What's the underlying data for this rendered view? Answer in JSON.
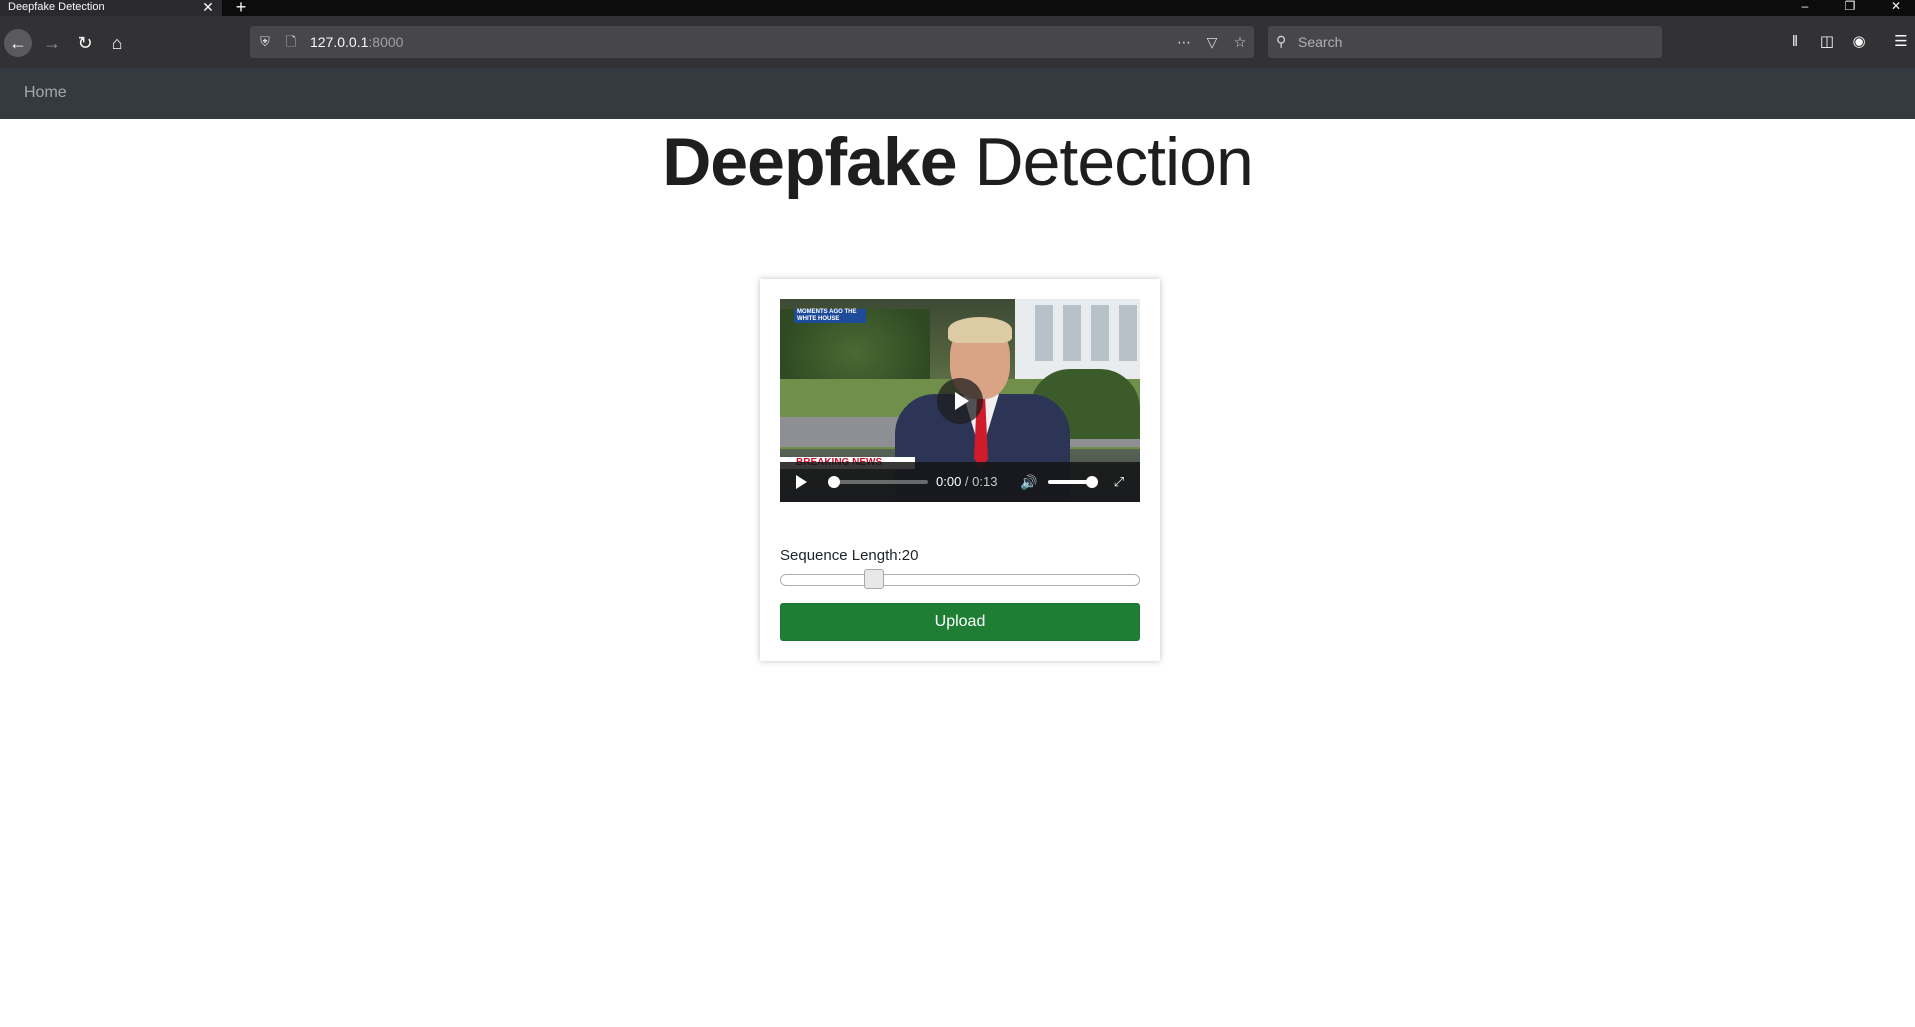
{
  "browser": {
    "tab_title": "Deepfake Detection",
    "tab_close": "✕",
    "new_tab": "+",
    "url_host": "127.0.0.1",
    "url_port": ":8000",
    "search_placeholder": "Search",
    "window_controls": [
      "–",
      "❐",
      "✕"
    ]
  },
  "site_nav": {
    "home_label": "Home"
  },
  "page": {
    "title_bold": "Deepfake",
    "title_light": "Detection"
  },
  "video": {
    "badge_text": "MOMENTS AGO THE WHITE HOUSE",
    "banner_text": "BREAKING NEWS",
    "current_time": "0:00",
    "separator": " / ",
    "duration": "0:13",
    "progress": 0.0,
    "volume": 1.0
  },
  "form": {
    "sequence_label": "Sequence Length:",
    "sequence_value": "20",
    "upload_label": "Upload"
  },
  "colors": {
    "nav_bg": "#343a40",
    "upload_bg": "#1e7e34"
  }
}
